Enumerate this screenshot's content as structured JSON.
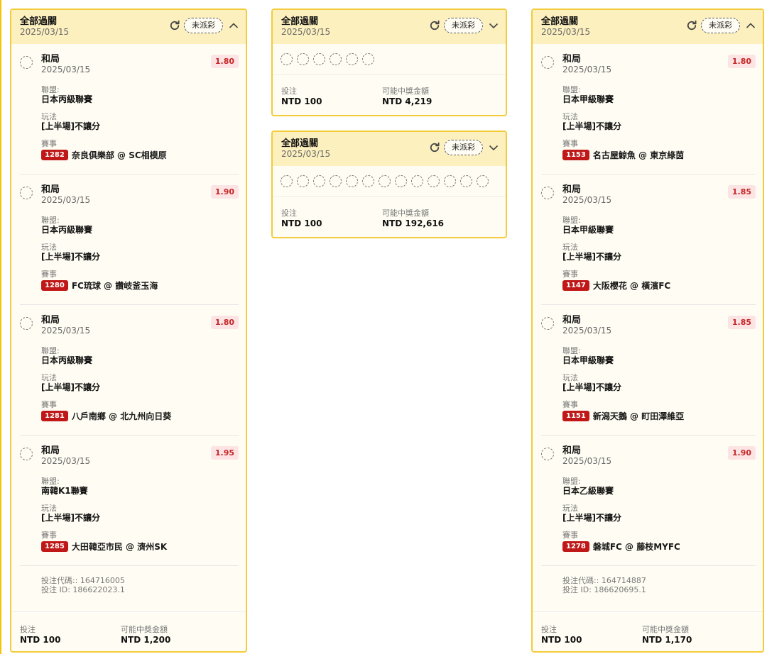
{
  "common": {
    "parlay_title": "全部過關",
    "bet_date": "2025/03/15",
    "status": "未派彩",
    "league_label": "聯盟:",
    "play_label": "玩法",
    "match_label": "賽事",
    "stake_label": "投注",
    "payout_label": "可能中獎金額",
    "code_prefix": "投注代碼:: ",
    "id_prefix": "投注 ID: "
  },
  "cards": [
    {
      "expanded": true,
      "code": "164716005",
      "bet_id": "186622023.1",
      "stake": "NTD 100",
      "payout": "NTD 1,200",
      "legs": [
        {
          "pick": "和局",
          "date": "2025/03/15",
          "odds": "1.80",
          "league": "日本丙級聯賽",
          "play": "[上半場]不讓分",
          "match_no": "1282",
          "match": "奈良俱樂部 @ SC相模原"
        },
        {
          "pick": "和局",
          "date": "2025/03/15",
          "odds": "1.90",
          "league": "日本丙級聯賽",
          "play": "[上半場]不讓分",
          "match_no": "1280",
          "match": "FC琉球 @ 讚岐釜玉海"
        },
        {
          "pick": "和局",
          "date": "2025/03/15",
          "odds": "1.80",
          "league": "日本丙級聯賽",
          "play": "[上半場]不讓分",
          "match_no": "1281",
          "match": "八戶南鄉 @ 北九州向日葵"
        },
        {
          "pick": "和局",
          "date": "2025/03/15",
          "odds": "1.95",
          "league": "南韓K1聯賽",
          "play": "[上半場]不讓分",
          "match_no": "1285",
          "match": "大田韓亞市民 @ 濟州SK"
        }
      ]
    },
    {
      "expanded": false,
      "legs_count": 6,
      "stake": "NTD 100",
      "payout": "NTD 4,219"
    },
    {
      "expanded": false,
      "legs_count": 13,
      "stake": "NTD 100",
      "payout": "NTD 192,616"
    },
    {
      "expanded": true,
      "code": "164714887",
      "bet_id": "186620695.1",
      "stake": "NTD 100",
      "payout": "NTD 1,170",
      "legs": [
        {
          "pick": "和局",
          "date": "2025/03/15",
          "odds": "1.80",
          "league": "日本甲級聯賽",
          "play": "[上半場]不讓分",
          "match_no": "1153",
          "match": "名古屋鯨魚 @ 東京綠茵"
        },
        {
          "pick": "和局",
          "date": "2025/03/15",
          "odds": "1.85",
          "league": "日本甲級聯賽",
          "play": "[上半場]不讓分",
          "match_no": "1147",
          "match": "大阪櫻花 @ 橫濱FC"
        },
        {
          "pick": "和局",
          "date": "2025/03/15",
          "odds": "1.85",
          "league": "日本甲級聯賽",
          "play": "[上半場]不讓分",
          "match_no": "1151",
          "match": "新潟天鵝 @ 町田澤維亞"
        },
        {
          "pick": "和局",
          "date": "2025/03/15",
          "odds": "1.90",
          "league": "日本乙級聯賽",
          "play": "[上半場]不讓分",
          "match_no": "1278",
          "match": "磐城FC @ 藤枝MYFC"
        }
      ]
    }
  ],
  "colors": {
    "border": "#f2cc3a",
    "header_bg": "#fdf0bf",
    "odds_bg": "#fde4e4",
    "odds_text": "#c62828",
    "match_badge": "#c01818"
  }
}
